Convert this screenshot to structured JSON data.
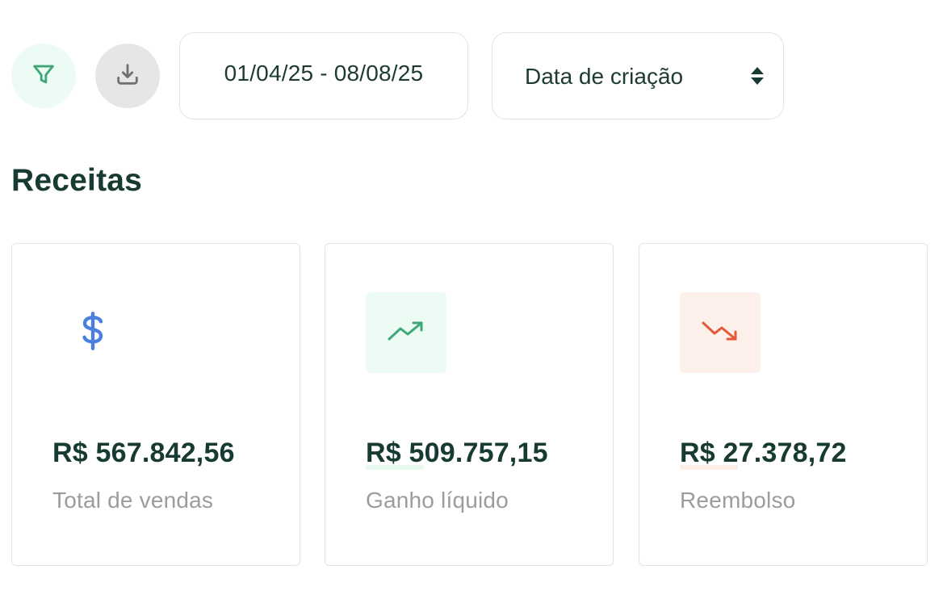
{
  "toolbar": {
    "filter_icon": "filter-icon",
    "download_icon": "download-icon",
    "date_range": "01/04/25 - 08/08/25",
    "sort_label": "Data de criação",
    "sort_icon": "sort-arrows-icon"
  },
  "section": {
    "title": "Receitas"
  },
  "cards": [
    {
      "icon": "dollar-icon",
      "amount": "R$ 567.842,56",
      "label": "Total de vendas",
      "color": "#4a7fe0"
    },
    {
      "icon": "trending-up-icon",
      "amount": "R$ 509.757,15",
      "label": "Ganho líquido",
      "color": "#3fa777"
    },
    {
      "icon": "trending-down-icon",
      "amount": "R$ 27.378,72",
      "label": "Reembolso",
      "color": "#e4583a"
    }
  ],
  "colors": {
    "heading": "#173b33",
    "muted_text": "#9c9c9c",
    "accent_green_bg": "#ecfbf3",
    "accent_red_bg": "#fdf0ea"
  }
}
